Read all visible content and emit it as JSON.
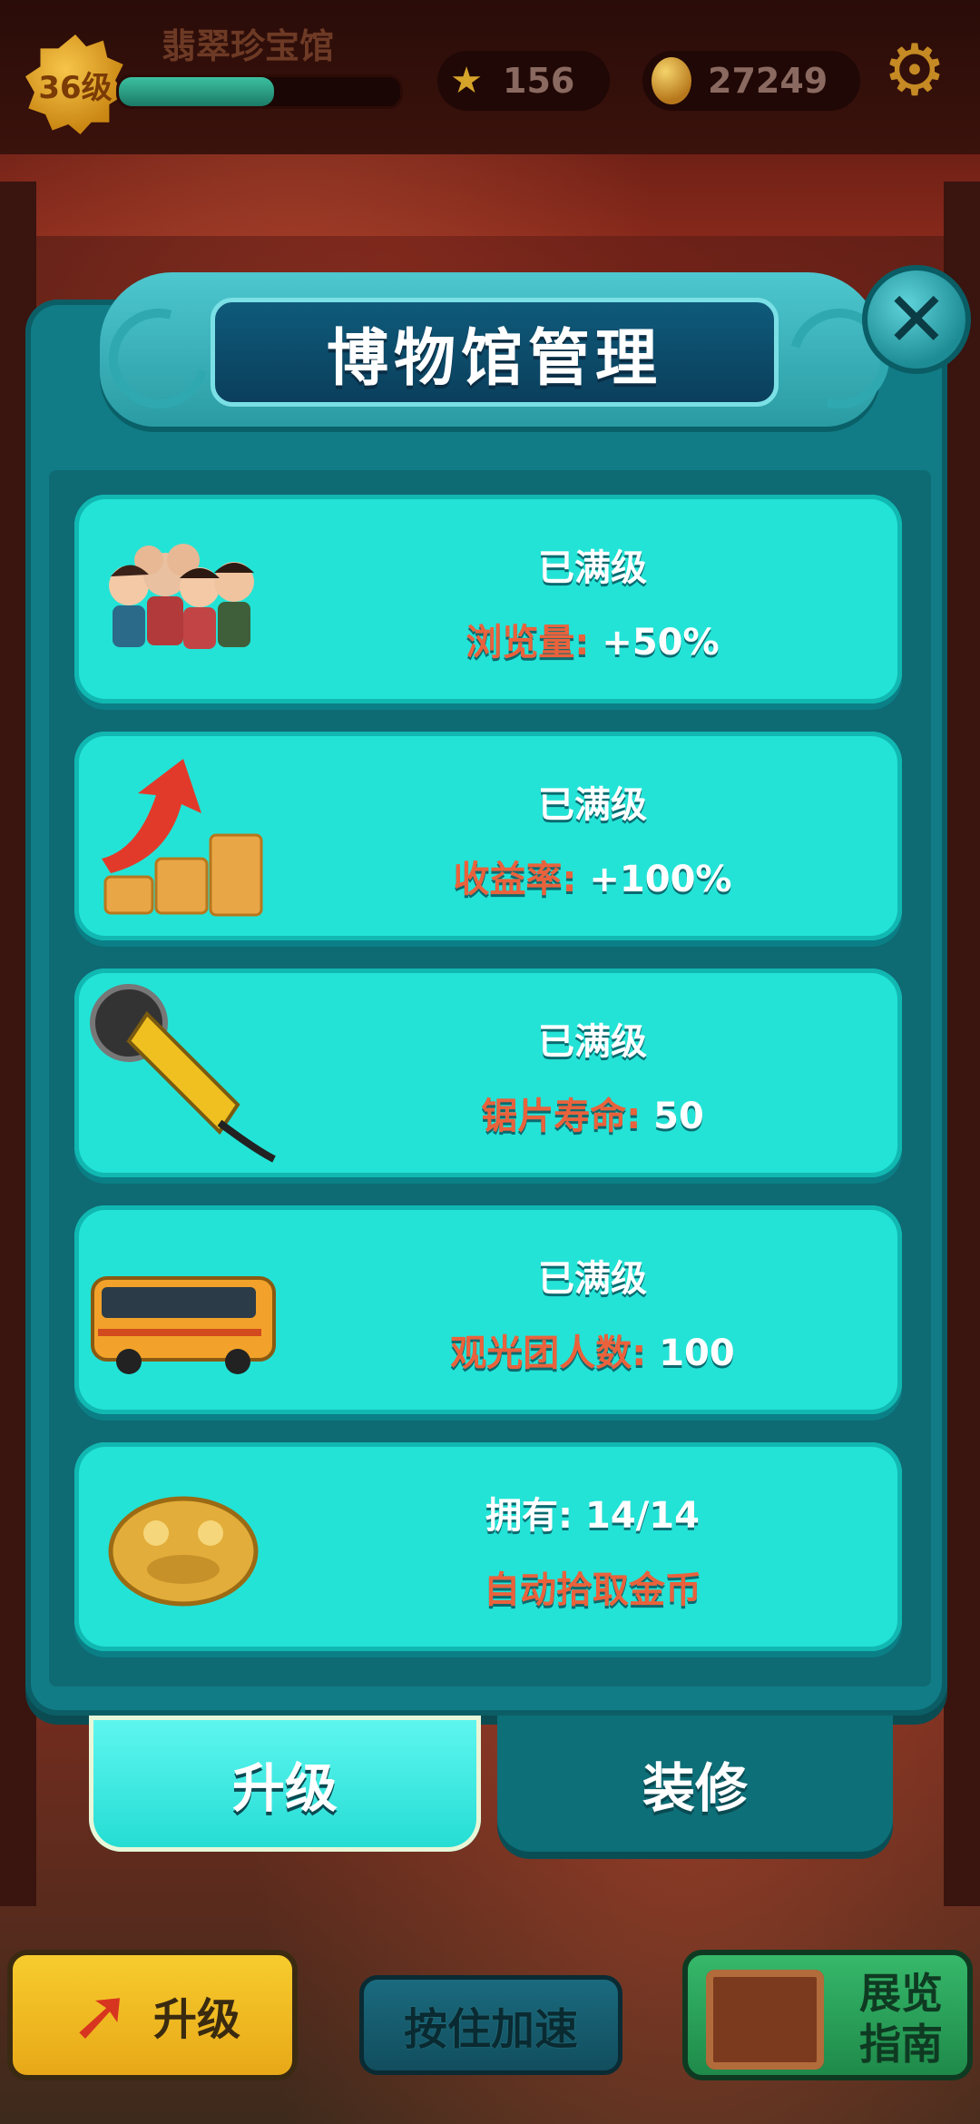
{
  "hud": {
    "level": "36级",
    "museum_name": "翡翠珍宝馆",
    "xp_fraction": 0.55,
    "stars": "156",
    "coins": "27249"
  },
  "modal": {
    "title": "博物馆管理",
    "close_icon": "close-icon",
    "cards": [
      {
        "icon": "visitors-group",
        "line1": "已满级",
        "label": "浏览量:",
        "value": " +50%"
      },
      {
        "icon": "coins-arrow-up",
        "line1": "已满级",
        "label": "收益率:",
        "value": " +100%"
      },
      {
        "icon": "angle-grinder",
        "line1": "已满级",
        "label": "锯片寿命:",
        "value": " 50"
      },
      {
        "icon": "tour-bus",
        "line1": "已满级",
        "label": "观光团人数:",
        "value": " 100"
      },
      {
        "icon": "golden-toad",
        "line1": "拥有: 14/14",
        "label": "自动拾取金币",
        "value": ""
      }
    ],
    "tabs": {
      "upgrade": "升级",
      "decorate": "装修"
    }
  },
  "bottom": {
    "upgrade_button": "升级",
    "boost_button": "按住加速",
    "guide_button_line1": "展览",
    "guide_button_line2": "指南"
  },
  "colors": {
    "card_bg": "#23e3d6",
    "modal_bg": "#117c86",
    "stat_label": "#e9623c",
    "accent_gold": "#f7cc2d"
  }
}
